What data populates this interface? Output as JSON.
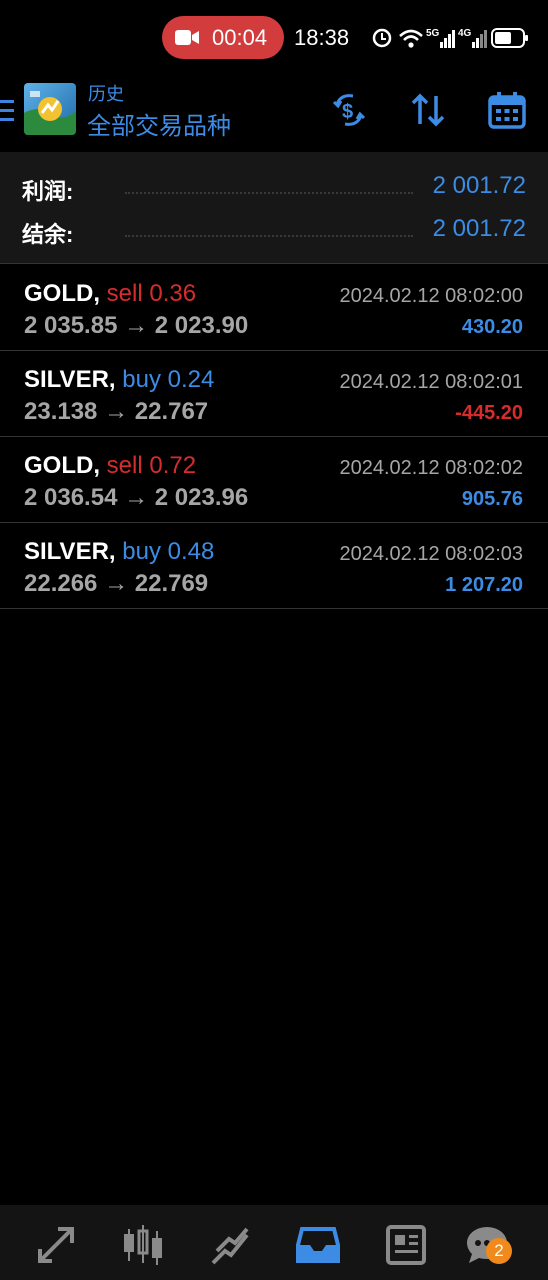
{
  "status_bar": {
    "recording_time": "00:04",
    "clock": "18:38",
    "icons": [
      "recording-camera-icon",
      "timer-icon",
      "wifi-icon",
      "signal-5g-icon",
      "signal-4g-icon",
      "battery-icon"
    ]
  },
  "header": {
    "subtitle": "历史",
    "title": "全部交易品种",
    "actions": [
      "currency-exchange-icon",
      "sort-icon",
      "calendar-icon"
    ]
  },
  "summary": {
    "profit_label": "利润:",
    "profit_value": "2 001.72",
    "balance_label": "结余:",
    "balance_value": "2 001.72"
  },
  "deals": [
    {
      "symbol": "GOLD,",
      "side": "sell 0.36",
      "side_type": "sell",
      "prices": "2 035.85 → 2 023.90",
      "time": "2024.02.12 08:02:00",
      "profit": "430.20",
      "profit_sign": "pos"
    },
    {
      "symbol": "SILVER,",
      "side": "buy 0.24",
      "side_type": "buy",
      "prices": "23.138 → 22.767",
      "time": "2024.02.12 08:02:01",
      "profit": "-445.20",
      "profit_sign": "neg"
    },
    {
      "symbol": "GOLD,",
      "side": "sell 0.72",
      "side_type": "sell",
      "prices": "2 036.54 → 2 023.96",
      "time": "2024.02.12 08:02:02",
      "profit": "905.76",
      "profit_sign": "pos"
    },
    {
      "symbol": "SILVER,",
      "side": "buy 0.48",
      "side_type": "buy",
      "prices": "22.266 → 22.769",
      "time": "2024.02.12 08:02:03",
      "profit": "1 207.20",
      "profit_sign": "pos"
    }
  ],
  "bottom_nav": {
    "items": [
      "quotes-icon",
      "chart-icon",
      "trade-icon",
      "history-icon",
      "news-icon",
      "chat-icon"
    ],
    "active": "history-icon",
    "chat_badge": "2"
  },
  "colors": {
    "accent": "#3c8ce6",
    "sell": "#d82c2c",
    "background": "#000000",
    "panel": "#171717",
    "text_secondary": "#a6a6a6"
  }
}
